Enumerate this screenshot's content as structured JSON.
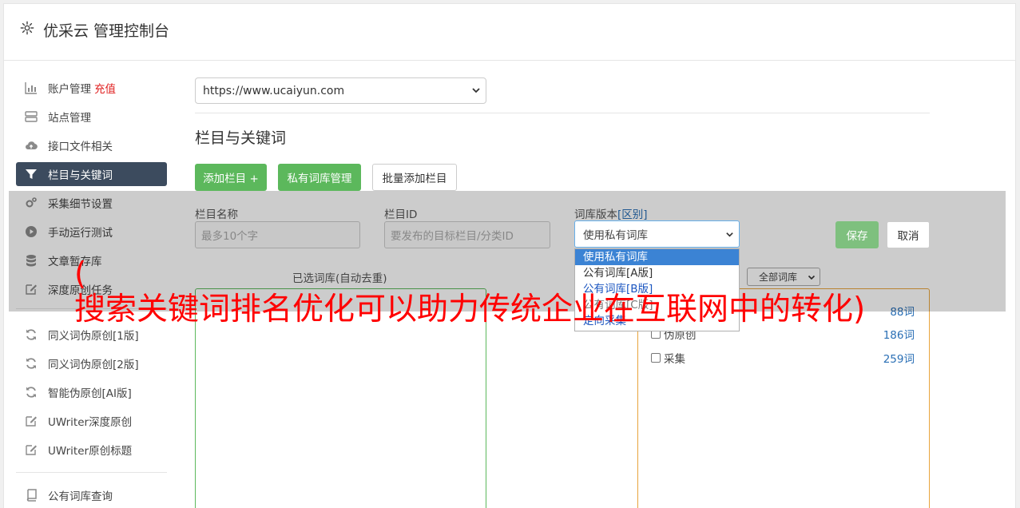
{
  "header": {
    "title": "优采云 管理控制台",
    "icon": "gear-icon"
  },
  "sidebar": {
    "items": [
      {
        "label": "账户管理",
        "badge": "充值",
        "icon": "bar-chart-icon",
        "active": false
      },
      {
        "label": "站点管理",
        "icon": "server-icon",
        "active": false
      },
      {
        "label": "接口文件相关",
        "icon": "cloud-upload-icon",
        "active": false
      },
      {
        "label": "栏目与关键词",
        "icon": "filter-icon",
        "active": true
      },
      {
        "label": "采集细节设置",
        "icon": "cogs-icon",
        "active": false
      },
      {
        "label": "手动运行测试",
        "icon": "play-circle-icon",
        "active": false
      },
      {
        "label": "文章暂存库",
        "icon": "database-icon",
        "active": false
      },
      {
        "label": "深度原创任务",
        "icon": "edit-icon",
        "active": false
      },
      {
        "label": "同义词伪原创[1版]",
        "icon": "refresh-icon",
        "active": false
      },
      {
        "label": "同义词伪原创[2版]",
        "icon": "refresh-icon",
        "active": false
      },
      {
        "label": "智能伪原创[AI版]",
        "icon": "refresh-icon",
        "active": false
      },
      {
        "label": "UWriter深度原创",
        "icon": "edit-icon",
        "active": false
      },
      {
        "label": "UWriter原创标题",
        "icon": "edit-icon",
        "active": false
      },
      {
        "label": "公有词库查询",
        "icon": "book-icon",
        "active": false
      }
    ]
  },
  "main": {
    "site_select": "https://www.ucaiyun.com",
    "section_title": "栏目与关键词",
    "buttons": {
      "add_column": "添加栏目 +",
      "private_library": "私有词库管理",
      "batch_add": "批量添加栏目"
    },
    "form": {
      "column_name_label": "栏目名称",
      "column_name_placeholder": "最多10个字",
      "column_id_label": "栏目ID",
      "column_id_placeholder": "要发布的目标栏目/分类ID",
      "library_version_label": "词库版本",
      "library_version_link": "[区别]",
      "library_version_value": "使用私有词库",
      "library_version_options": [
        "使用私有词库",
        "公有词库[A版]",
        "公有词库[B版]",
        "公有词库[C版]",
        "定向采集"
      ],
      "save": "保存",
      "cancel": "取消"
    },
    "selected_panel_label": "已选词库(自动去重)",
    "library_filter": "全部词库",
    "libraries": [
      {
        "name": "",
        "count": "88词"
      },
      {
        "name": "伪原创",
        "count": "186词"
      },
      {
        "name": "采集",
        "count": "259词"
      }
    ]
  },
  "banner": {
    "paren": "(",
    "text": "搜索关键词排名优化可以助力传统企业在互联网中的转化)"
  },
  "colors": {
    "accent_green": "#5cb85c",
    "active_nav": "#3c4b5e",
    "banner_red": "#ff0000",
    "link_blue": "#2a6fb5"
  }
}
